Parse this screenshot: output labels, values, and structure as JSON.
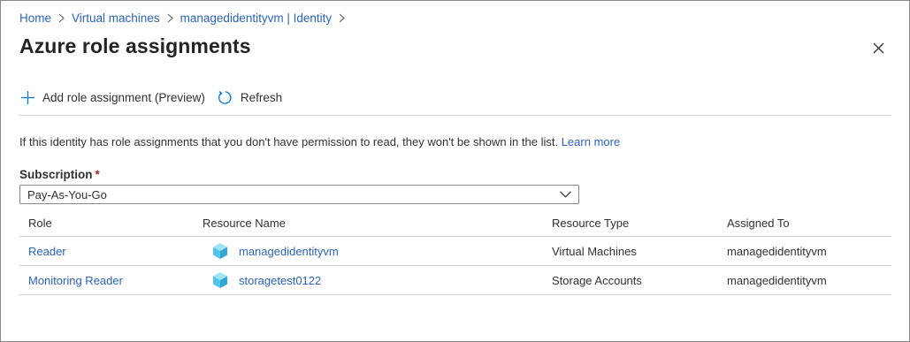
{
  "breadcrumb": {
    "items": [
      {
        "label": "Home"
      },
      {
        "label": "Virtual machines"
      },
      {
        "label": "managedidentityvm | Identity"
      }
    ]
  },
  "page": {
    "title": "Azure role assignments"
  },
  "toolbar": {
    "add_label": "Add role assignment (Preview)",
    "refresh_label": "Refresh"
  },
  "info": {
    "text": "If this identity has role assignments that you don't have permission to read, they won't be shown in the list.",
    "link": "Learn more"
  },
  "subscription": {
    "label": "Subscription",
    "required_marker": "*",
    "selected": "Pay-As-You-Go"
  },
  "table": {
    "columns": [
      "Role",
      "Resource Name",
      "Resource Type",
      "Assigned To"
    ],
    "rows": [
      {
        "role": "Reader",
        "resource_name": "managedidentityvm",
        "resource_type": "Virtual Machines",
        "assigned_to": "managedidentityvm"
      },
      {
        "role": "Monitoring Reader",
        "resource_name": "storagetest0122",
        "resource_type": "Storage Accounts",
        "assigned_to": "managedidentityvm"
      }
    ]
  },
  "colors": {
    "link": "#2b63b5",
    "accent": "#0078d4",
    "required": "#a4262c",
    "cube": "#50c7e8"
  },
  "icons": [
    "chevron-right-icon",
    "close-icon",
    "plus-icon",
    "refresh-icon",
    "chevron-down-icon",
    "cube-icon"
  ]
}
